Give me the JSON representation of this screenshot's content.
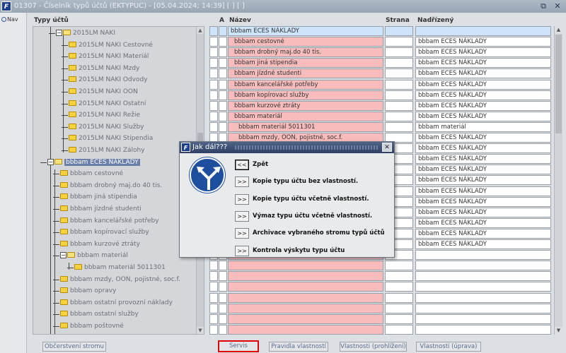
{
  "window": {
    "title": "01307 - Číselník typů účtů (EKTYPUC) - [05.04.2024; 14:39]  [ ]  [ ]",
    "app_icon": "F",
    "restore_label": "⧉",
    "close_label": "✕"
  },
  "nav": {
    "label": "Nav"
  },
  "tree": {
    "header": "Typy účtů",
    "items": [
      {
        "label": "2015LM NAKI",
        "type": "open-folder"
      },
      {
        "label": "2015LM NAKI Cestovné",
        "type": "folder"
      },
      {
        "label": "2015LM NAKI Materiál",
        "type": "folder"
      },
      {
        "label": "2015LM NAKI Mzdy",
        "type": "folder"
      },
      {
        "label": "2015LM NAKI Odvody",
        "type": "folder"
      },
      {
        "label": "2015LM NAKI OON",
        "type": "folder"
      },
      {
        "label": "2015LM NAKI Ostatní",
        "type": "folder"
      },
      {
        "label": "2015LM NAKI Režie",
        "type": "folder"
      },
      {
        "label": "2015LM NAKI Služby",
        "type": "folder"
      },
      {
        "label": "2015LM NAKI Stipendia",
        "type": "folder"
      },
      {
        "label": "2015LM NAKI Zálohy",
        "type": "folder"
      },
      {
        "label": "bbbam ECES NÁKLADY",
        "type": "open-folder"
      },
      {
        "label": "bbbam cestovné",
        "type": "folder"
      },
      {
        "label": "bbbam drobný maj.do 40 tis.",
        "type": "folder"
      },
      {
        "label": "bbbam jiná stipendia",
        "type": "folder"
      },
      {
        "label": "bbbam jízdné studenti",
        "type": "folder"
      },
      {
        "label": "bbbam kancelářské potřeby",
        "type": "folder"
      },
      {
        "label": "bbbam kopírovací služby",
        "type": "folder"
      },
      {
        "label": "bbbam kurzové ztráty",
        "type": "folder"
      },
      {
        "label": "bbbam materiál",
        "type": "open-folder"
      },
      {
        "label": "bbbam materiál 5011301",
        "type": "folder"
      },
      {
        "label": "bbbam mzdy, OON, pojistné, soc.f.",
        "type": "folder"
      },
      {
        "label": "bbbam opravy",
        "type": "folder"
      },
      {
        "label": "bbbam ostatní provozní náklady",
        "type": "folder"
      },
      {
        "label": "bbbam ostatní služby",
        "type": "folder"
      },
      {
        "label": "bbbam poštovné",
        "type": "folder"
      }
    ]
  },
  "grid": {
    "headers": {
      "a": "A",
      "name": "Název",
      "strana": "Strana",
      "nadrizeny": "Nadřízený"
    },
    "rows": [
      {
        "name": "bbbam ECES NÁKLADY",
        "strana": "",
        "nadrizeny": ""
      },
      {
        "name": "bbbam cestovné",
        "strana": "",
        "nadrizeny": "bbbam ECES NÁKLADY"
      },
      {
        "name": "bbbam drobný maj.do 40 tis.",
        "strana": "",
        "nadrizeny": "bbbam ECES NÁKLADY"
      },
      {
        "name": "bbbam jiná stipendia",
        "strana": "",
        "nadrizeny": "bbbam ECES NÁKLADY"
      },
      {
        "name": "bbbam jízdné studenti",
        "strana": "",
        "nadrizeny": "bbbam ECES NÁKLADY"
      },
      {
        "name": "bbbam kancelářské potřeby",
        "strana": "",
        "nadrizeny": "bbbam ECES NÁKLADY"
      },
      {
        "name": "bbbam kopírovací služby",
        "strana": "",
        "nadrizeny": "bbbam ECES NÁKLADY"
      },
      {
        "name": "bbbam kurzové ztráty",
        "strana": "",
        "nadrizeny": "bbbam ECES NÁKLADY"
      },
      {
        "name": "bbbam materiál",
        "strana": "",
        "nadrizeny": "bbbam ECES NÁKLADY"
      },
      {
        "name": "bbbam materiál 5011301",
        "strana": "",
        "nadrizeny": "bbbam materiál"
      },
      {
        "name": "bbbam mzdy, OON, pojistné, soc.f.",
        "strana": "",
        "nadrizeny": "bbbam ECES NÁKLADY"
      },
      {
        "name": "",
        "strana": "",
        "nadrizeny": "bbbam ECES NÁKLADY"
      },
      {
        "name": "",
        "strana": "",
        "nadrizeny": "bbbam ECES NÁKLADY"
      },
      {
        "name": "",
        "strana": "",
        "nadrizeny": "bbbam ECES NÁKLADY"
      },
      {
        "name": "",
        "strana": "",
        "nadrizeny": "bbbam ECES NÁKLADY"
      },
      {
        "name": "",
        "strana": "",
        "nadrizeny": "bbbam ECES NÁKLADY"
      },
      {
        "name": "",
        "strana": "",
        "nadrizeny": "bbbam ECES NÁKLADY"
      },
      {
        "name": "",
        "strana": "",
        "nadrizeny": "bbbam ECES NÁKLADY"
      },
      {
        "name": "",
        "strana": "",
        "nadrizeny": "bbbam ECES NÁKLADY"
      },
      {
        "name": "",
        "strana": "",
        "nadrizeny": "bbbam ECES NÁKLADY"
      },
      {
        "name": "",
        "strana": "",
        "nadrizeny": "bbbam ECES NÁKLADY"
      },
      {
        "name": "",
        "strana": "",
        "nadrizeny": ""
      },
      {
        "name": "",
        "strana": "",
        "nadrizeny": ""
      },
      {
        "name": "",
        "strana": "",
        "nadrizeny": ""
      },
      {
        "name": "",
        "strana": "",
        "nadrizeny": ""
      },
      {
        "name": "",
        "strana": "",
        "nadrizeny": ""
      },
      {
        "name": "",
        "strana": "",
        "nadrizeny": ""
      },
      {
        "name": "",
        "strana": "",
        "nadrizeny": ""
      },
      {
        "name": "",
        "strana": "",
        "nadrizeny": ""
      }
    ]
  },
  "buttons": {
    "refresh": "Občerstvení stromu",
    "servis": "Servis",
    "rules": "Pravidla vlastností",
    "view": "Vlastnosti (prohlížení)",
    "edit": "Vlastnosti (úprava)"
  },
  "dialog": {
    "title": "Jak dál???",
    "close_label": "✕",
    "icon": "road-sign-split-icon",
    "options": [
      {
        "btn": "<<",
        "label": "Zpět"
      },
      {
        "btn": ">>",
        "label": "Kopie typu účtu bez vlastností."
      },
      {
        "btn": ">>",
        "label": "Kopie typu účtu včetně vlastností."
      },
      {
        "btn": ">>",
        "label": "Výmaz typu účtu včetně vlastností."
      },
      {
        "btn": ">>",
        "label": "Archivace vybraného stromu typů účtů"
      },
      {
        "btn": ">>",
        "label": "Kontrola výskytu typu účtu"
      }
    ]
  },
  "colors": {
    "name_cell": "#f8bcbc",
    "selected_row": "#cde4fb",
    "dialog_title": "#2e4065",
    "highlight_border": "#e00000"
  }
}
